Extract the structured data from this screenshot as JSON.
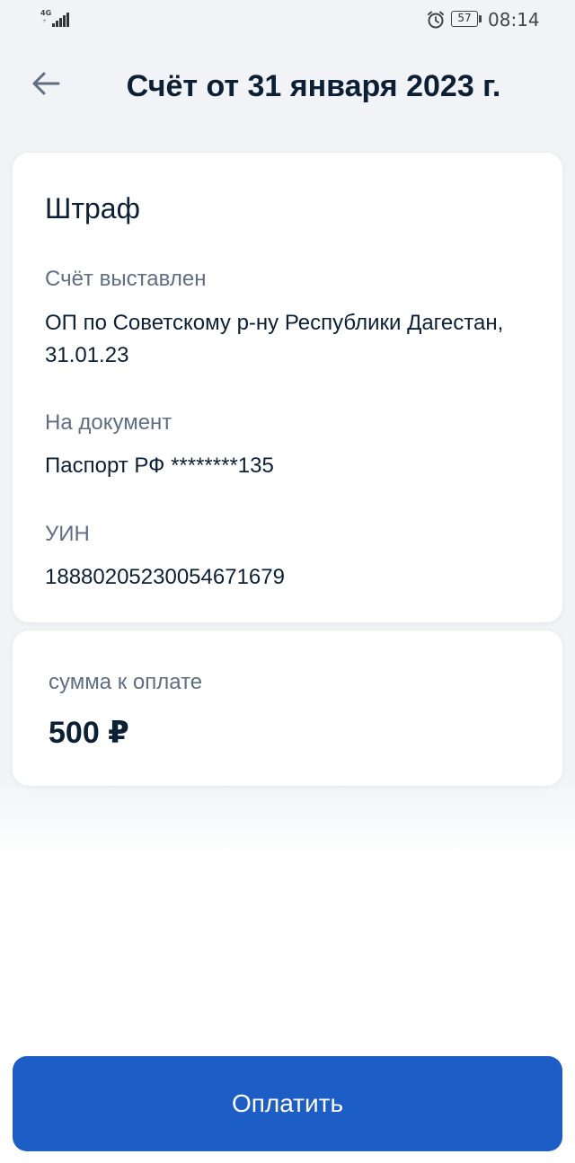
{
  "status_bar": {
    "network_type": "4G",
    "network_sub": "+",
    "battery_level": "57",
    "time": "08:14",
    "icons": [
      "signal-icon",
      "alarm-icon",
      "battery-icon"
    ]
  },
  "header": {
    "title": "Счёт от 31 января 2023 г.",
    "back_icon": "arrow-left-icon"
  },
  "bill": {
    "heading": "Штраф",
    "issued_label": "Счёт выставлен",
    "issued_value": "ОП по Советскому р-ну Республики Дагестан, 31.01.23",
    "document_label": "На документ",
    "document_value": "Паспорт РФ ********135",
    "uin_label": "УИН",
    "uin_value": "18880205230054671679"
  },
  "payment": {
    "sum_label": "сумма к оплате",
    "sum_value": "500 ₽"
  },
  "actions": {
    "pay_label": "Оплатить"
  },
  "colors": {
    "background": "#f1f3f6",
    "card": "#ffffff",
    "title": "#0b1f35",
    "secondary_text": "#5f6e82",
    "primary_button": "#1c5dc6",
    "button_text": "#ffffff",
    "back_arrow": "#5f6e82"
  }
}
